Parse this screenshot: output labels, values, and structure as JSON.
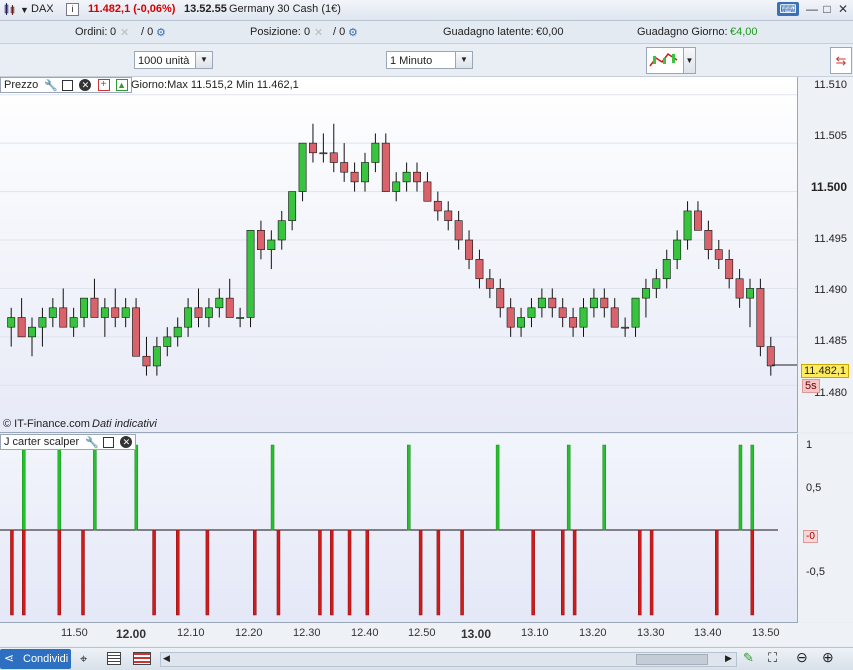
{
  "titlebar": {
    "instrument": "DAX",
    "price": "11.482,1 (-0,06%)",
    "time": "13.52.55",
    "name": "Germany 30 Cash (1€)"
  },
  "inforow": {
    "orders_label": "Ordini:",
    "orders_value": "0",
    "orders_sep": "/ 0",
    "position_label": "Posizione:",
    "position_value": "0",
    "position_sep": "/ 0",
    "latent_label": "Guadagno latente:",
    "latent_value": "€0,00",
    "day_label": "Guadagno Giorno:",
    "day_value": "€4,00"
  },
  "selectors": {
    "quantity": "1000 unità",
    "interval": "1 Minuto"
  },
  "price_panel": {
    "tag": "Prezzo",
    "day_info": "Giorno:Max 11.515,2 Min 11.462,1",
    "watermark": "© IT-Finance.com",
    "watermark_note": "Dati indicativi",
    "current_price": "11.482,1",
    "countdown": "5s",
    "axis_labels": [
      "11.510",
      "11.505",
      "11.500",
      "11.495",
      "11.490",
      "11.485",
      "11.480"
    ]
  },
  "indicator_panel": {
    "tag": "J carter scalper",
    "axis_labels": [
      "1",
      "0,5",
      "-0,5"
    ],
    "current_value": "-0"
  },
  "time_axis": [
    "11.50",
    "12.00",
    "12.10",
    "12.20",
    "12.30",
    "12.40",
    "12.50",
    "13.00",
    "13.10",
    "13.20",
    "13.30",
    "13.40",
    "13.50"
  ],
  "bottombar": {
    "share_label": "Condividi"
  },
  "colors": {
    "up": "#39c43f",
    "down": "#d9636b",
    "signal_up": "#22c22a",
    "signal_down": "#d11a1a",
    "profit": "#1a9c1a",
    "loss": "#d40000"
  },
  "chart_data": {
    "type": "candlestick",
    "x_range": [
      "11.43",
      "13.53"
    ],
    "y_range": [
      11479,
      11511
    ],
    "ohlc_approx": [
      [
        11486,
        11488,
        11484,
        11487
      ],
      [
        11487,
        11489,
        11486,
        11485
      ],
      [
        11485,
        11487,
        11483,
        11486
      ],
      [
        11486,
        11488,
        11484,
        11487
      ],
      [
        11487,
        11489,
        11486,
        11488
      ],
      [
        11488,
        11490,
        11486,
        11486
      ],
      [
        11486,
        11488,
        11485,
        11487
      ],
      [
        11487,
        11489,
        11486,
        11489
      ],
      [
        11489,
        11491,
        11487,
        11487
      ],
      [
        11487,
        11489,
        11485,
        11488
      ],
      [
        11488,
        11490,
        11486,
        11487
      ],
      [
        11487,
        11489,
        11486,
        11488
      ],
      [
        11488,
        11489,
        11485,
        11483
      ],
      [
        11483,
        11485,
        11481,
        11482
      ],
      [
        11482,
        11485,
        11481,
        11484
      ],
      [
        11484,
        11486,
        11483,
        11485
      ],
      [
        11485,
        11487,
        11484,
        11486
      ],
      [
        11486,
        11489,
        11485,
        11488
      ],
      [
        11488,
        11490,
        11486,
        11487
      ],
      [
        11487,
        11489,
        11486,
        11488
      ],
      [
        11488,
        11490,
        11487,
        11489
      ],
      [
        11489,
        11491,
        11487,
        11487
      ],
      [
        11487,
        11488,
        11486,
        11487
      ],
      [
        11487,
        11496,
        11486,
        11496
      ],
      [
        11496,
        11497,
        11493,
        11494
      ],
      [
        11494,
        11496,
        11492,
        11495
      ],
      [
        11495,
        11498,
        11494,
        11497
      ],
      [
        11497,
        11500,
        11496,
        11500
      ],
      [
        11500,
        11505,
        11499,
        11505
      ],
      [
        11505,
        11507,
        11503,
        11504
      ],
      [
        11504,
        11506,
        11503,
        11504
      ],
      [
        11504,
        11507,
        11502,
        11503
      ],
      [
        11503,
        11505,
        11501,
        11502
      ],
      [
        11502,
        11503,
        11500,
        11501
      ],
      [
        11501,
        11504,
        11500,
        11503
      ],
      [
        11503,
        11506,
        11502,
        11505
      ],
      [
        11505,
        11506,
        11500,
        11500
      ],
      [
        11500,
        11502,
        11499,
        11501
      ],
      [
        11501,
        11503,
        11500,
        11502
      ],
      [
        11502,
        11503,
        11500,
        11501
      ],
      [
        11501,
        11502,
        11499,
        11499
      ],
      [
        11499,
        11500,
        11497,
        11498
      ],
      [
        11498,
        11499,
        11496,
        11497
      ],
      [
        11497,
        11498,
        11494,
        11495
      ],
      [
        11495,
        11496,
        11492,
        11493
      ],
      [
        11493,
        11494,
        11490,
        11491
      ],
      [
        11491,
        11492,
        11489,
        11490
      ],
      [
        11490,
        11491,
        11487,
        11488
      ],
      [
        11488,
        11489,
        11485,
        11486
      ],
      [
        11486,
        11488,
        11485,
        11487
      ],
      [
        11487,
        11489,
        11486,
        11488
      ],
      [
        11488,
        11490,
        11487,
        11489
      ],
      [
        11489,
        11490,
        11487,
        11488
      ],
      [
        11488,
        11489,
        11486,
        11487
      ],
      [
        11487,
        11488,
        11485,
        11486
      ],
      [
        11486,
        11489,
        11485,
        11488
      ],
      [
        11488,
        11490,
        11487,
        11489
      ],
      [
        11489,
        11490,
        11487,
        11488
      ],
      [
        11488,
        11489,
        11486,
        11486
      ],
      [
        11486,
        11487,
        11485,
        11486
      ],
      [
        11486,
        11489,
        11485,
        11489
      ],
      [
        11489,
        11491,
        11487,
        11490
      ],
      [
        11490,
        11492,
        11489,
        11491
      ],
      [
        11491,
        11494,
        11490,
        11493
      ],
      [
        11493,
        11496,
        11492,
        11495
      ],
      [
        11495,
        11499,
        11494,
        11498
      ],
      [
        11498,
        11499,
        11496,
        11496
      ],
      [
        11496,
        11497,
        11493,
        11494
      ],
      [
        11494,
        11495,
        11492,
        11493
      ],
      [
        11493,
        11494,
        11490,
        11491
      ],
      [
        11491,
        11492,
        11488,
        11489
      ],
      [
        11489,
        11491,
        11486,
        11490
      ],
      [
        11490,
        11491,
        11483,
        11484
      ],
      [
        11484,
        11485,
        11481,
        11482
      ]
    ],
    "indicator": {
      "name": "J carter scalper",
      "y_range": [
        -1,
        1
      ],
      "up_signals_x": [
        "11.46",
        "11.52",
        "11.58",
        "12.05",
        "12.28",
        "12.51",
        "13.06",
        "13.18",
        "13.24",
        "13.47",
        "13.49"
      ],
      "down_signals_x": [
        "11.44",
        "11.46",
        "11.52",
        "11.56",
        "12.08",
        "12.12",
        "12.17",
        "12.25",
        "12.29",
        "12.36",
        "12.38",
        "12.41",
        "12.44",
        "12.53",
        "12.56",
        "13.00",
        "13.12",
        "13.17",
        "13.19",
        "13.30",
        "13.32",
        "13.43",
        "13.49"
      ]
    }
  }
}
